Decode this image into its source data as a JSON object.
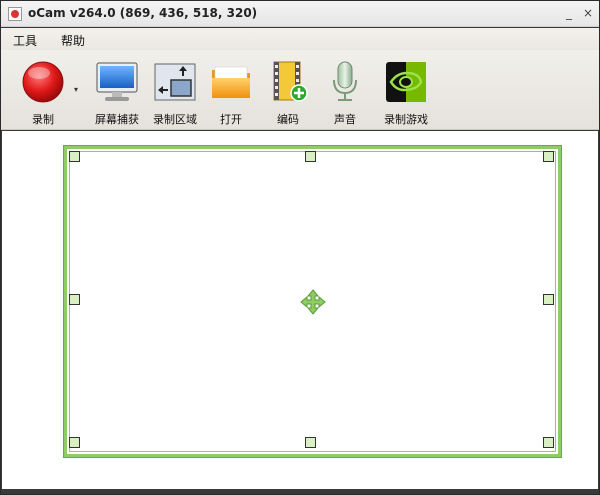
{
  "window": {
    "title": "oCam v264.0 (869, 436, 518, 320)",
    "minimize_glyph": "_",
    "close_glyph": "×"
  },
  "menu": {
    "tools_label": "工具",
    "help_label": "帮助"
  },
  "toolbar": {
    "items": [
      {
        "label": "录制",
        "icon": "record-icon"
      },
      {
        "label": "屏幕捕获",
        "icon": "monitor-icon"
      },
      {
        "label": "录制区域",
        "icon": "resize-area-icon"
      },
      {
        "label": "打开",
        "icon": "folder-icon"
      },
      {
        "label": "编码",
        "icon": "film-add-icon"
      },
      {
        "label": "声音",
        "icon": "microphone-icon"
      },
      {
        "label": "录制游戏",
        "icon": "nvidia-icon"
      }
    ],
    "dropdown_glyph": "▾"
  },
  "colors": {
    "frame_green": "#8fcc63",
    "record_red": "#e02020",
    "nvidia_green": "#76b900"
  }
}
